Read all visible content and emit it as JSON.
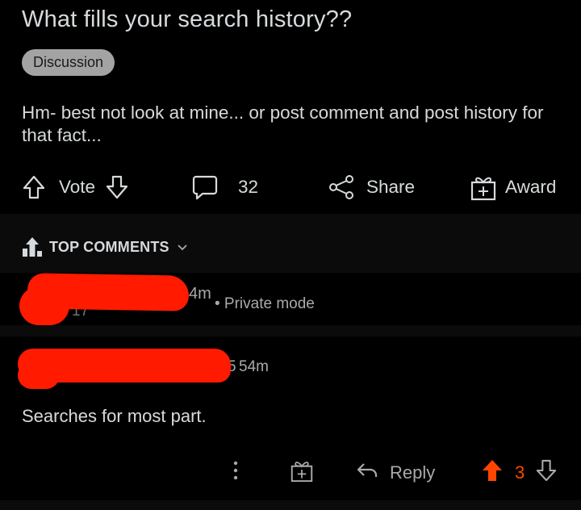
{
  "post": {
    "title": "What fills your search history??",
    "flair": "Discussion",
    "body": "Hm- best not look at mine... or post comment and post history for that fact...",
    "actions": {
      "vote_label": "Vote",
      "comments_count": "32",
      "share_label": "Share",
      "award_label": "Award"
    }
  },
  "comments_header": {
    "label": "TOP COMMENTS"
  },
  "comments": [
    {
      "author_partial": "17",
      "time": "4m",
      "meta": "• Private mode"
    },
    {
      "time_prefix": "5",
      "time": "54m",
      "body": "Searches for most part.",
      "actions": {
        "reply_label": "Reply",
        "score": "3"
      }
    }
  ],
  "colors": {
    "background": "#000000",
    "separator": "#0b0b0b",
    "text": "#d7dadc",
    "muted_text": "#a8aaab",
    "flair_bg": "#a3a3a3",
    "upvote_accent": "#ff4500",
    "redaction": "#ff1a00"
  }
}
